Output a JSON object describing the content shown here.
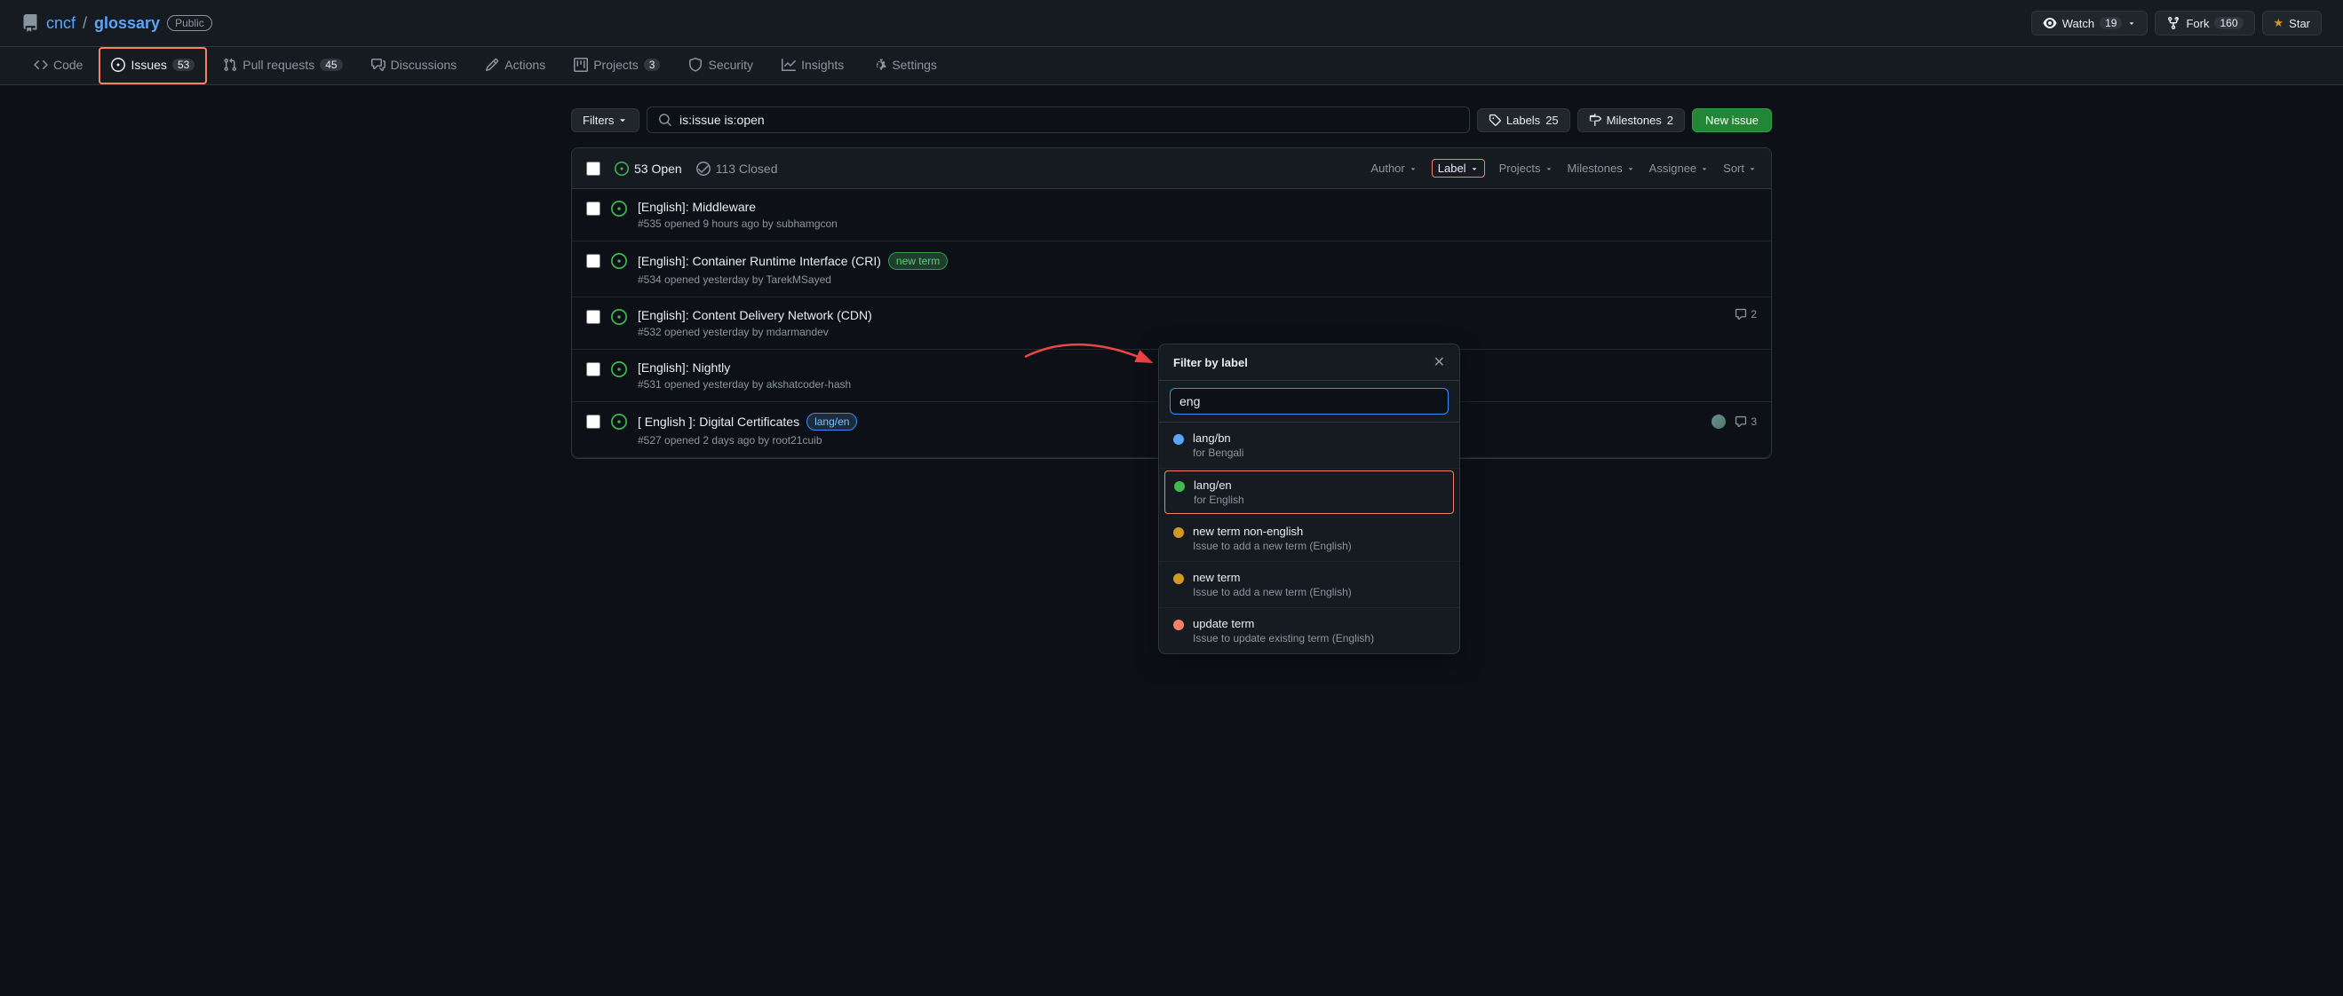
{
  "header": {
    "org": "cncf",
    "repo": "glossary",
    "public_label": "Public",
    "watch_label": "Watch",
    "watch_count": "19",
    "fork_label": "Fork",
    "fork_count": "160",
    "star_label": "Star"
  },
  "nav": {
    "tabs": [
      {
        "id": "code",
        "label": "Code",
        "badge": null
      },
      {
        "id": "issues",
        "label": "Issues",
        "badge": "53",
        "active": true
      },
      {
        "id": "pull-requests",
        "label": "Pull requests",
        "badge": "45"
      },
      {
        "id": "discussions",
        "label": "Discussions",
        "badge": null
      },
      {
        "id": "actions",
        "label": "Actions",
        "badge": null
      },
      {
        "id": "projects",
        "label": "Projects",
        "badge": "3"
      },
      {
        "id": "security",
        "label": "Security",
        "badge": null
      },
      {
        "id": "insights",
        "label": "Insights",
        "badge": null
      },
      {
        "id": "settings",
        "label": "Settings",
        "badge": null
      }
    ]
  },
  "filters": {
    "filter_label": "Filters",
    "search_value": "is:issue is:open",
    "labels_label": "Labels",
    "labels_count": "25",
    "milestones_label": "Milestones",
    "milestones_count": "2",
    "new_issue_label": "New issue"
  },
  "issues_header": {
    "open_count": "53 Open",
    "closed_count": "113 Closed",
    "author_label": "Author",
    "label_label": "Label",
    "projects_label": "Projects",
    "milestones_label": "Milestones",
    "assignee_label": "Assignee",
    "sort_label": "Sort"
  },
  "issues": [
    {
      "id": "issue-535",
      "title": "[English]: Middleware",
      "number": "#535",
      "time": "9 hours ago",
      "author": "subhamgcon",
      "labels": [],
      "comments": null
    },
    {
      "id": "issue-534",
      "title": "[English]: Container Runtime Interface (CRI)",
      "number": "#534",
      "time": "yesterday",
      "author": "TarekMSayed",
      "labels": [
        {
          "text": "new term",
          "class": "label-new-term"
        }
      ],
      "comments": null
    },
    {
      "id": "issue-532",
      "title": "[English]: Content Delivery Network (CDN)",
      "number": "#532",
      "time": "yesterday",
      "author": "mdarmandev",
      "labels": [],
      "comments": 2
    },
    {
      "id": "issue-531",
      "title": "[English]: Nightly",
      "number": "#531",
      "time": "yesterday",
      "author": "akshatcoder-hash",
      "labels": [],
      "comments": null
    },
    {
      "id": "issue-527",
      "title": "[ English ]: Digital Certificates",
      "number": "#527",
      "time": "2 days ago",
      "author": "root21cuib",
      "labels": [
        {
          "text": "lang/en",
          "class": "label-lang-en"
        }
      ],
      "comments": 3
    }
  ],
  "dropdown": {
    "title": "Filter by label",
    "search_placeholder": "eng",
    "items": [
      {
        "id": "lang-bn",
        "label": "lang/bn",
        "description": "for Bengali",
        "dot_class": "dot-blue",
        "selected": false
      },
      {
        "id": "lang-en",
        "label": "lang/en",
        "description": "for English",
        "dot_class": "dot-green",
        "selected": true
      },
      {
        "id": "new-term-non-english",
        "label": "new term non-english",
        "description": "Issue to add a new term (English)",
        "dot_class": "dot-yellow",
        "selected": false
      },
      {
        "id": "new-term",
        "label": "new term",
        "description": "Issue to add a new term (English)",
        "dot_class": "dot-yellow",
        "selected": false
      },
      {
        "id": "update-term",
        "label": "update term",
        "description": "Issue to update existing term (English)",
        "dot_class": "dot-pink",
        "selected": false
      }
    ]
  }
}
